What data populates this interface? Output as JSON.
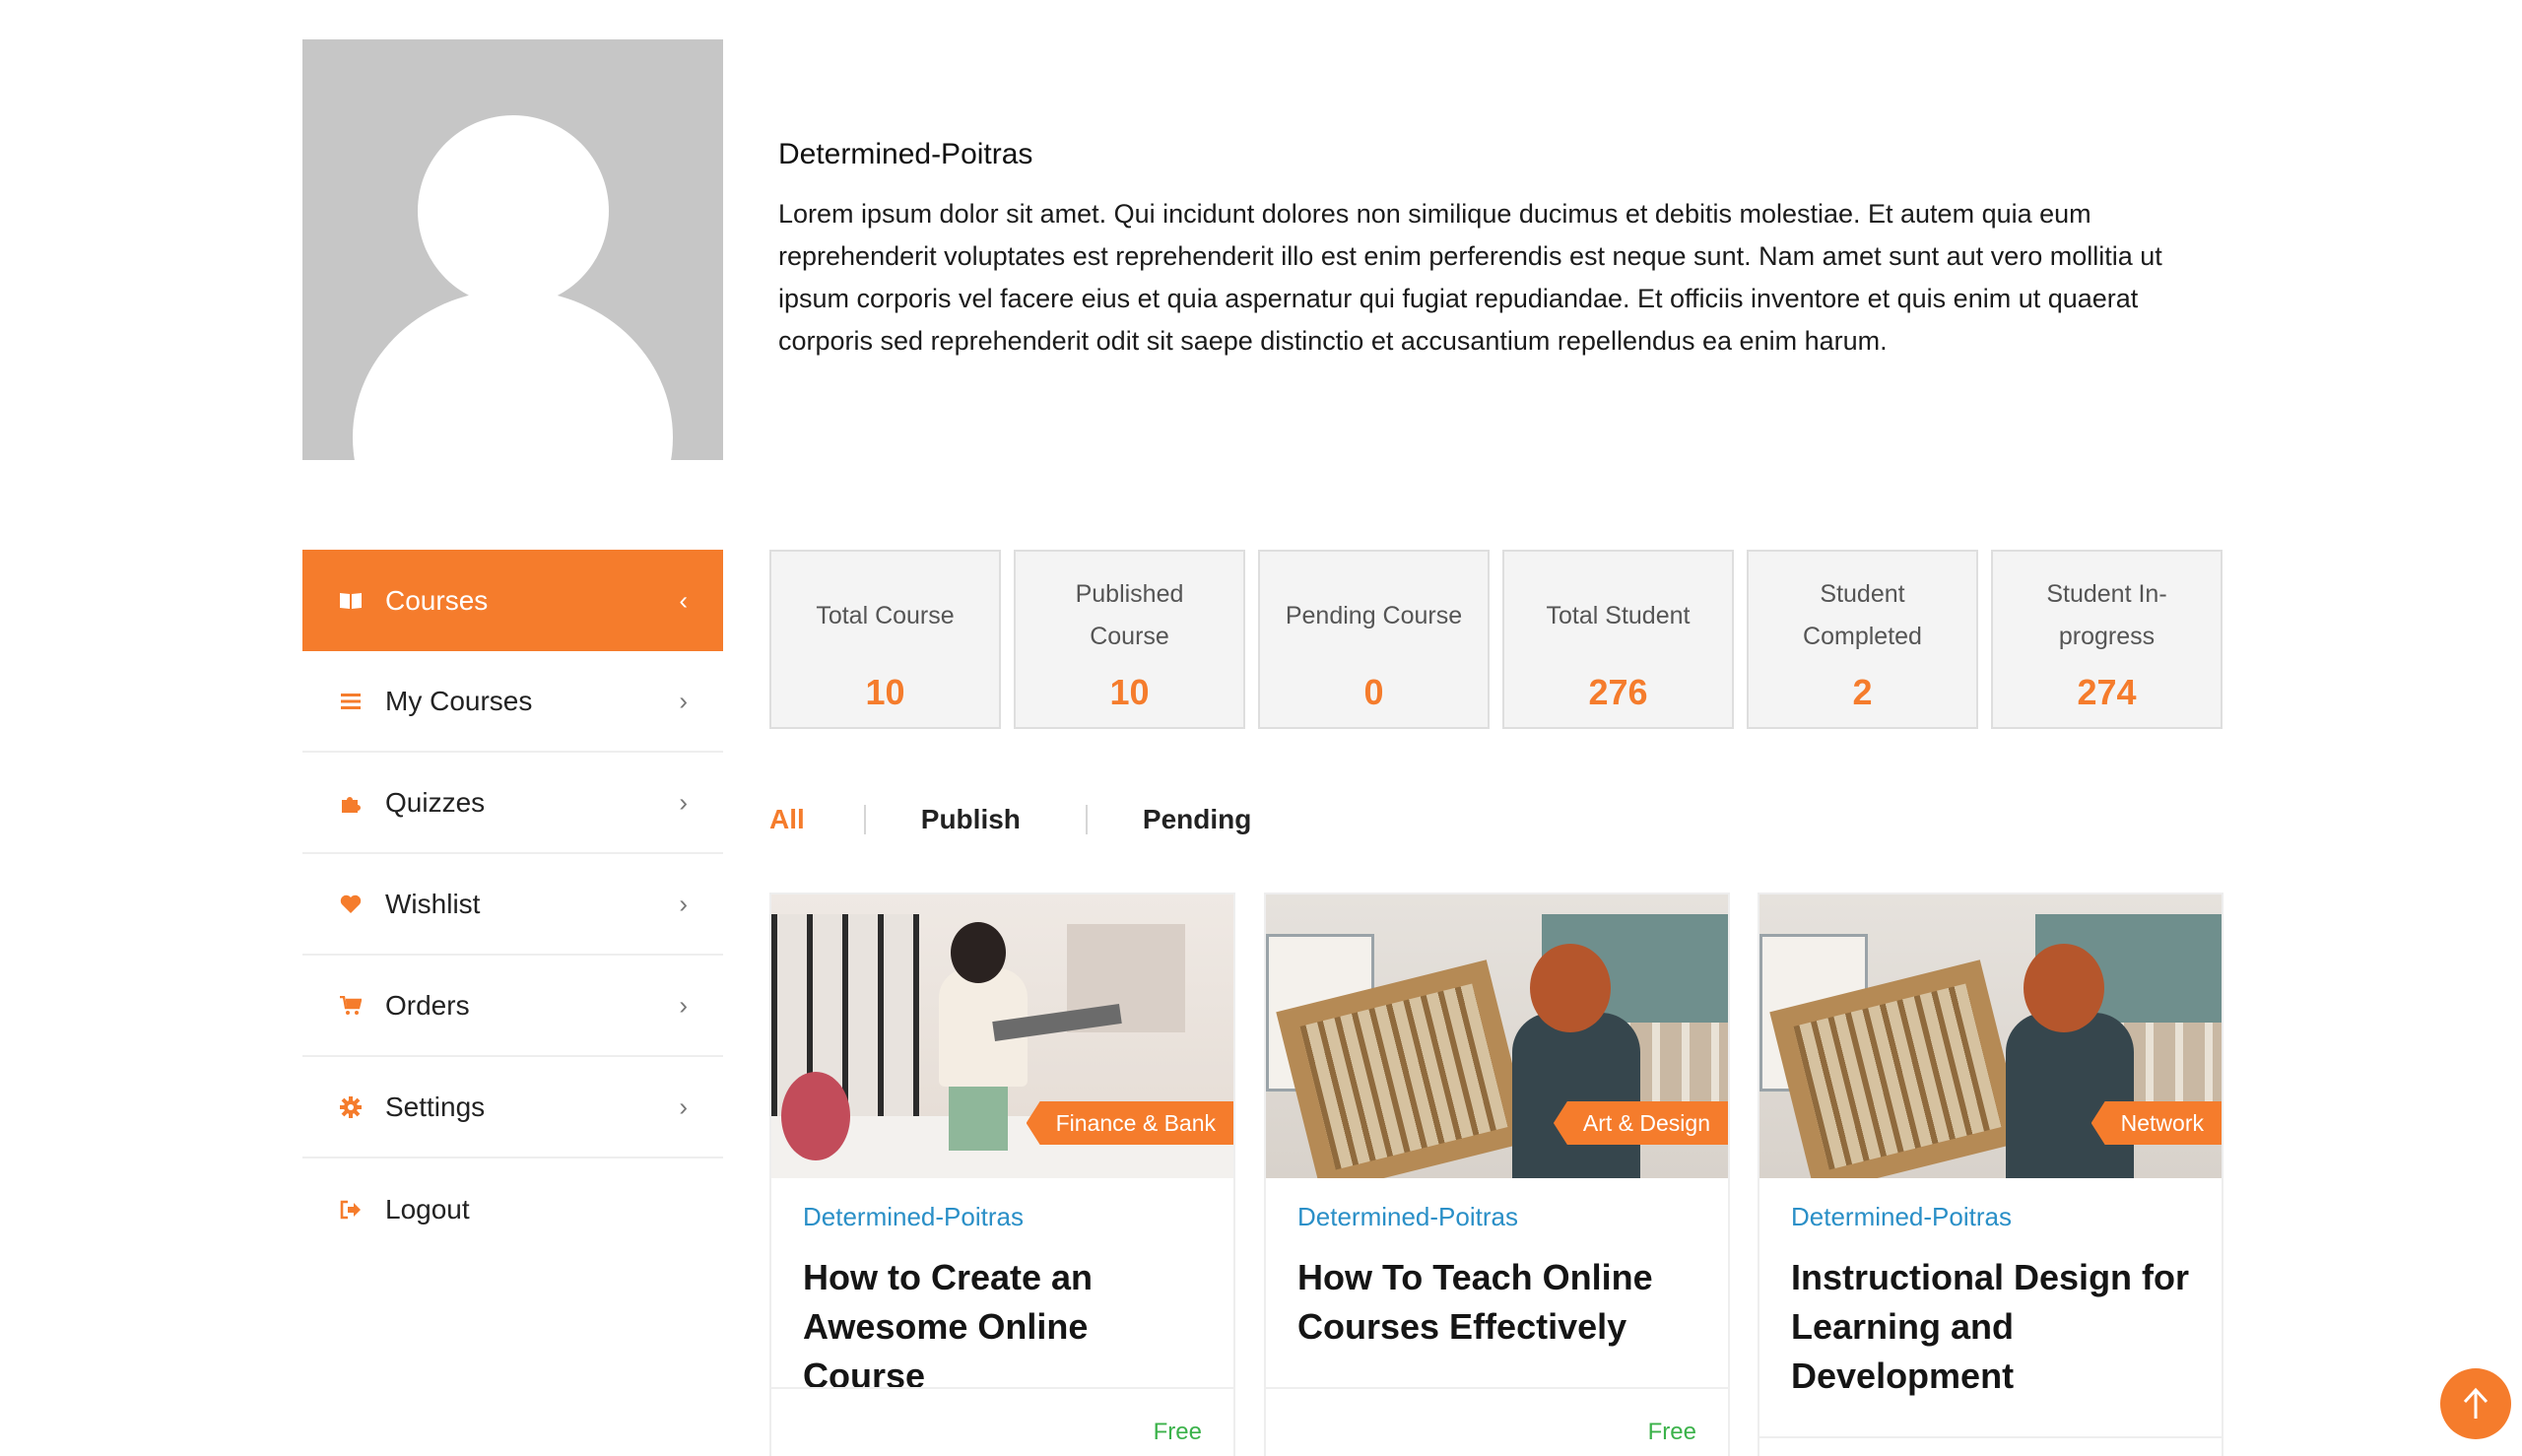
{
  "profile": {
    "name": "Determined-Poitras",
    "bio": "Lorem ipsum dolor sit amet. Qui incidunt dolores non similique ducimus et debitis molestiae. Et autem quia eum reprehenderit voluptates est reprehenderit illo est enim perferendis est neque sunt. Nam amet sunt aut vero mollitia ut ipsum corporis vel facere eius et quia aspernatur qui fugiat repudiandae. Et officiis inventore et quis enim ut quaerat corporis sed reprehenderit odit sit saepe distinctio et accusantium repellendus ea enim harum."
  },
  "sidebar": {
    "items": [
      {
        "label": "Courses",
        "icon": "book-open-icon"
      },
      {
        "label": "My Courses",
        "icon": "list-icon"
      },
      {
        "label": "Quizzes",
        "icon": "puzzle-icon"
      },
      {
        "label": "Wishlist",
        "icon": "heart-icon"
      },
      {
        "label": "Orders",
        "icon": "cart-icon"
      },
      {
        "label": "Settings",
        "icon": "gear-icon"
      },
      {
        "label": "Logout",
        "icon": "logout-icon"
      }
    ]
  },
  "stats": [
    {
      "label": "Total Course",
      "value": "10"
    },
    {
      "label": "Published Course",
      "value": "10"
    },
    {
      "label": "Pending Course",
      "value": "0"
    },
    {
      "label": "Total Student",
      "value": "276"
    },
    {
      "label": "Student Completed",
      "value": "2"
    },
    {
      "label": "Student In-progress",
      "value": "274"
    }
  ],
  "filter": {
    "tabs": [
      "All",
      "Publish",
      "Pending"
    ],
    "active": "All"
  },
  "courses": [
    {
      "category": "Finance & Bank",
      "author": "Determined-Poitras",
      "title": "How to Create an Awesome Online Course",
      "price": "Free"
    },
    {
      "category": "Art & Design",
      "author": "Determined-Poitras",
      "title": "How To Teach Online Courses Effectively",
      "price": "Free"
    },
    {
      "category": "Network",
      "author": "Determined-Poitras",
      "title": "Instructional Design for Learning and Development",
      "price": ""
    }
  ],
  "colors": {
    "accent": "#f57c2c",
    "author_link": "#2a8fc7",
    "price_free": "#3bb24a",
    "stat_bg": "#f4f4f4"
  },
  "back_to_top": {
    "icon": "arrow-up-icon"
  }
}
